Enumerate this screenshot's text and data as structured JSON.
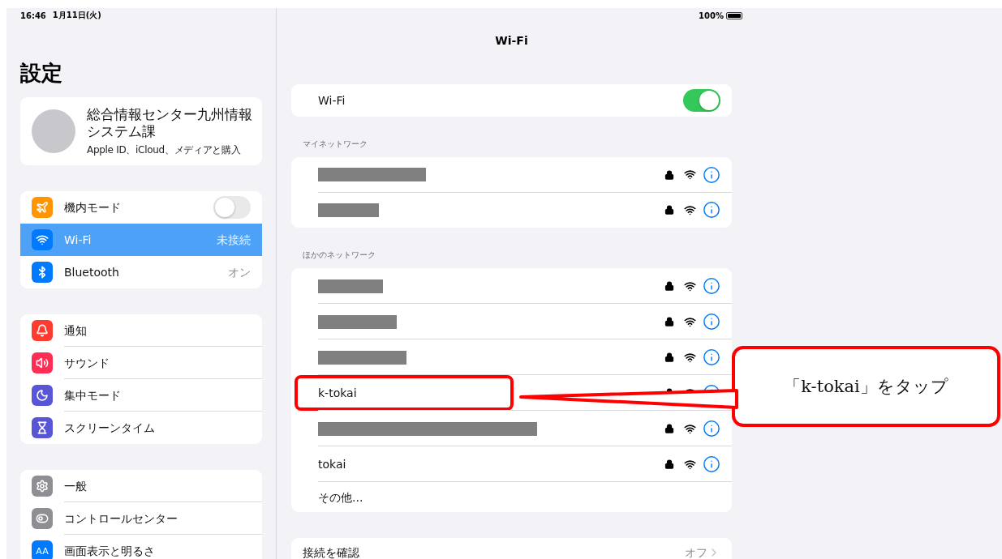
{
  "status_bar": {
    "time": "16:46",
    "date": "1月11日(火)",
    "battery": "100%"
  },
  "sidebar": {
    "title": "設定",
    "profile": {
      "name": "総合情報センター九州情報システム課",
      "subtitle": "Apple ID、iCloud、メディアと購入"
    },
    "groups": [
      {
        "items": [
          {
            "label": "機内モード",
            "kind": "toggle",
            "on": false,
            "selected": false
          },
          {
            "label": "Wi-Fi",
            "kind": "value",
            "value": "未接続",
            "selected": true
          },
          {
            "label": "Bluetooth",
            "kind": "value",
            "value": "オン",
            "selected": false
          }
        ]
      },
      {
        "items": [
          {
            "label": "通知",
            "kind": "plain",
            "selected": false
          },
          {
            "label": "サウンド",
            "kind": "plain",
            "selected": false
          },
          {
            "label": "集中モード",
            "kind": "plain",
            "selected": false
          },
          {
            "label": "スクリーンタイム",
            "kind": "plain",
            "selected": false
          }
        ]
      },
      {
        "items": [
          {
            "label": "一般",
            "kind": "plain",
            "selected": false
          },
          {
            "label": "コントロールセンター",
            "kind": "plain",
            "selected": false
          },
          {
            "label": "画面表示と明るさ",
            "kind": "plain",
            "icon_text": "AA",
            "selected": false
          }
        ]
      }
    ]
  },
  "detail": {
    "title": "Wi-Fi",
    "wifi_toggle": {
      "label": "Wi-Fi",
      "on": true
    },
    "sections": [
      {
        "header": "マイネットワーク",
        "networks": [
          {
            "kind": "redacted",
            "highlighted": false
          },
          {
            "kind": "redacted",
            "highlighted": false
          }
        ]
      },
      {
        "header": "ほかのネットワーク",
        "networks": [
          {
            "kind": "redacted",
            "highlighted": false
          },
          {
            "kind": "redacted",
            "highlighted": false
          },
          {
            "kind": "redacted",
            "highlighted": false
          },
          {
            "kind": "named",
            "name": "k-tokai",
            "highlighted": true
          },
          {
            "kind": "redacted",
            "highlighted": false
          },
          {
            "kind": "named",
            "name": "tokai",
            "highlighted": false
          },
          {
            "kind": "other",
            "name": "その他...",
            "highlighted": false
          }
        ]
      }
    ],
    "ask_to_join": {
      "label": "接続を確認",
      "value": "オフ"
    }
  },
  "callout": {
    "text": "「k-tokai」をタップ"
  }
}
